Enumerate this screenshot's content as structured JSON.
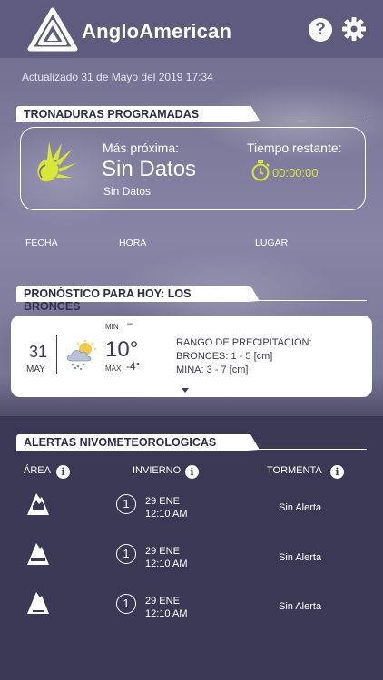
{
  "brand": "AngloAmerican",
  "icons": {
    "logo": "anglo-logo-icon",
    "help": "help-icon",
    "settings": "gear-icon"
  },
  "updated": "Actualizado 31 de Mayo del 2019 17:34",
  "tronaduras": {
    "title": "TRONADURAS PROGRAMADAS",
    "next_label": "Más próxima:",
    "next_value": "Sin Datos",
    "next_sub": "Sin Datos",
    "remaining_label": "Tiempo restante:",
    "remaining_value": "00:00:00",
    "columns": [
      "FECHA",
      "HORA",
      "LUGAR"
    ],
    "accent": "#d8e63a"
  },
  "forecast": {
    "title": "PRONÓSTICO PARA HOY: LOS BRONCES",
    "day": "31",
    "month": "MAY",
    "min_label": "MIN",
    "min_value": "–",
    "temp": "10°",
    "max_label": "MAX",
    "max_value": "-4°",
    "precip_title": "RANGO DE PRECIPITACION:",
    "precip_bronces": "BRONCES: 1 - 5 [cm]",
    "precip_mina": "MINA: 3 - 7 [cm]",
    "icon": "partly-cloudy-snow-icon"
  },
  "alerts": {
    "title": "ALERTAS NIVOMETEOROLOGICAS",
    "headers": [
      "ÁREA",
      "INVIERNO",
      "TORMENTA"
    ],
    "info_glyph": "i",
    "rows": [
      {
        "num": "1",
        "date": "29 ENE",
        "time": "12:10 AM",
        "status": "Sin Alerta"
      },
      {
        "num": "1",
        "date": "29 ENE",
        "time": "12:10 AM",
        "status": "Sin Alerta"
      },
      {
        "num": "1",
        "date": "29 ENE",
        "time": "12:10 AM",
        "status": "Sin Alerta"
      }
    ]
  }
}
